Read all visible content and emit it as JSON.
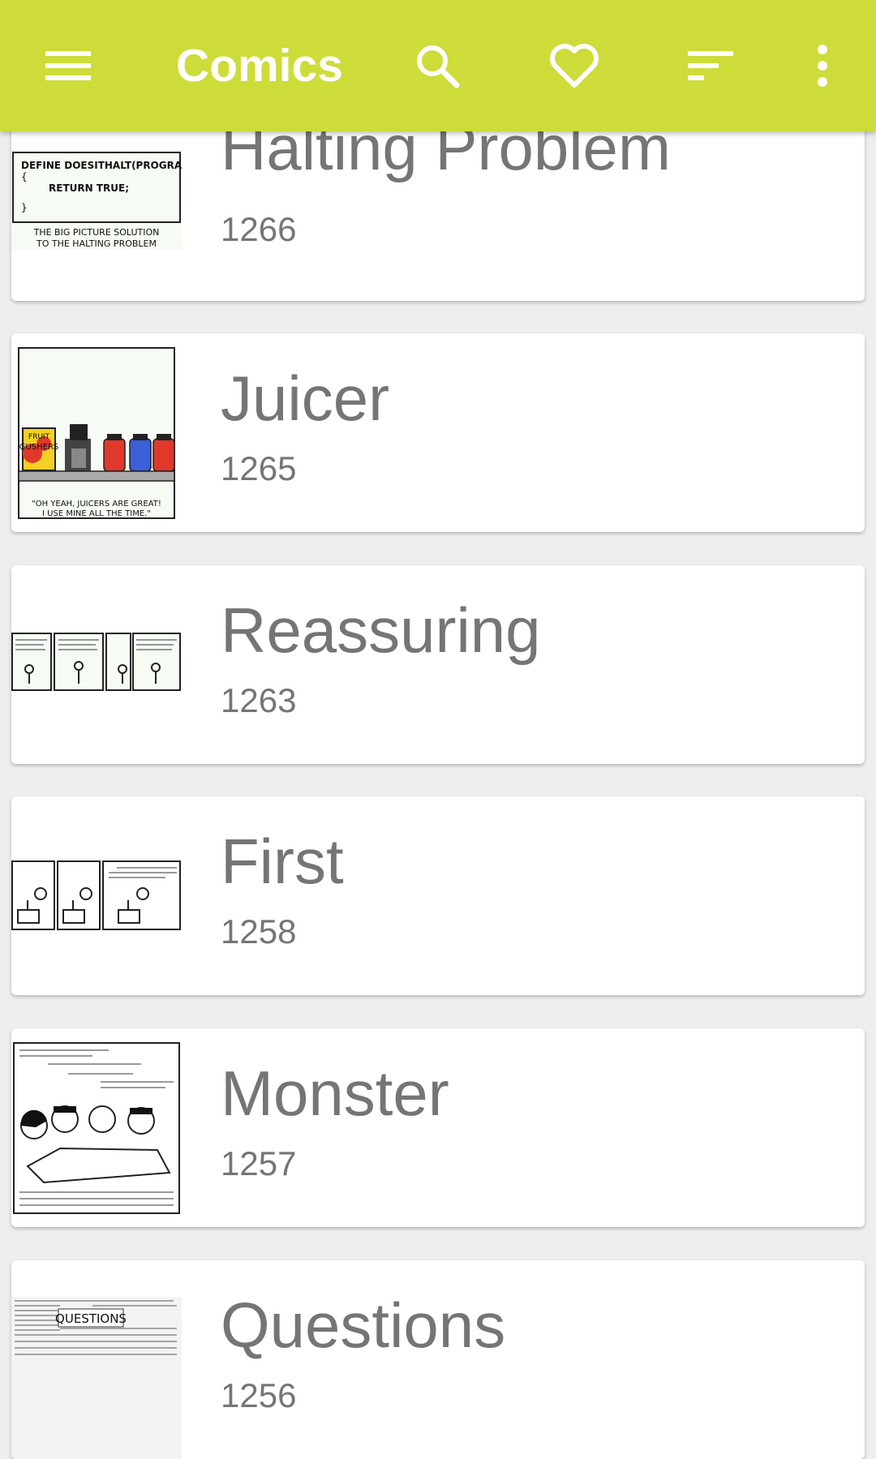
{
  "app_bar": {
    "title": "Comics",
    "icons": [
      "menu-icon",
      "search-icon",
      "heart-icon",
      "sort-icon",
      "more-vert-icon"
    ],
    "color": "#cddc39"
  },
  "comics": [
    {
      "title": "Halting Problem",
      "number": "1266",
      "thumb_text": [
        "DEFINE DOESITHALT(PROGRAM):",
        "{",
        "RETURN TRUE;",
        "}",
        "THE BIG PICTURE SOLUTION",
        "TO THE HALTING PROBLEM"
      ]
    },
    {
      "title": "Juicer",
      "number": "1265",
      "thumb_text": [
        "FRUIT",
        "GUSHERS",
        "\"OH YEAH, JUICERS ARE GREAT!",
        "I USE MINE ALL THE TIME.\""
      ]
    },
    {
      "title": "Reassuring",
      "number": "1263"
    },
    {
      "title": "First",
      "number": "1258"
    },
    {
      "title": "Monster",
      "number": "1257"
    },
    {
      "title": "Questions",
      "number": "1256",
      "thumb_text": [
        "QUESTIONS"
      ]
    }
  ]
}
